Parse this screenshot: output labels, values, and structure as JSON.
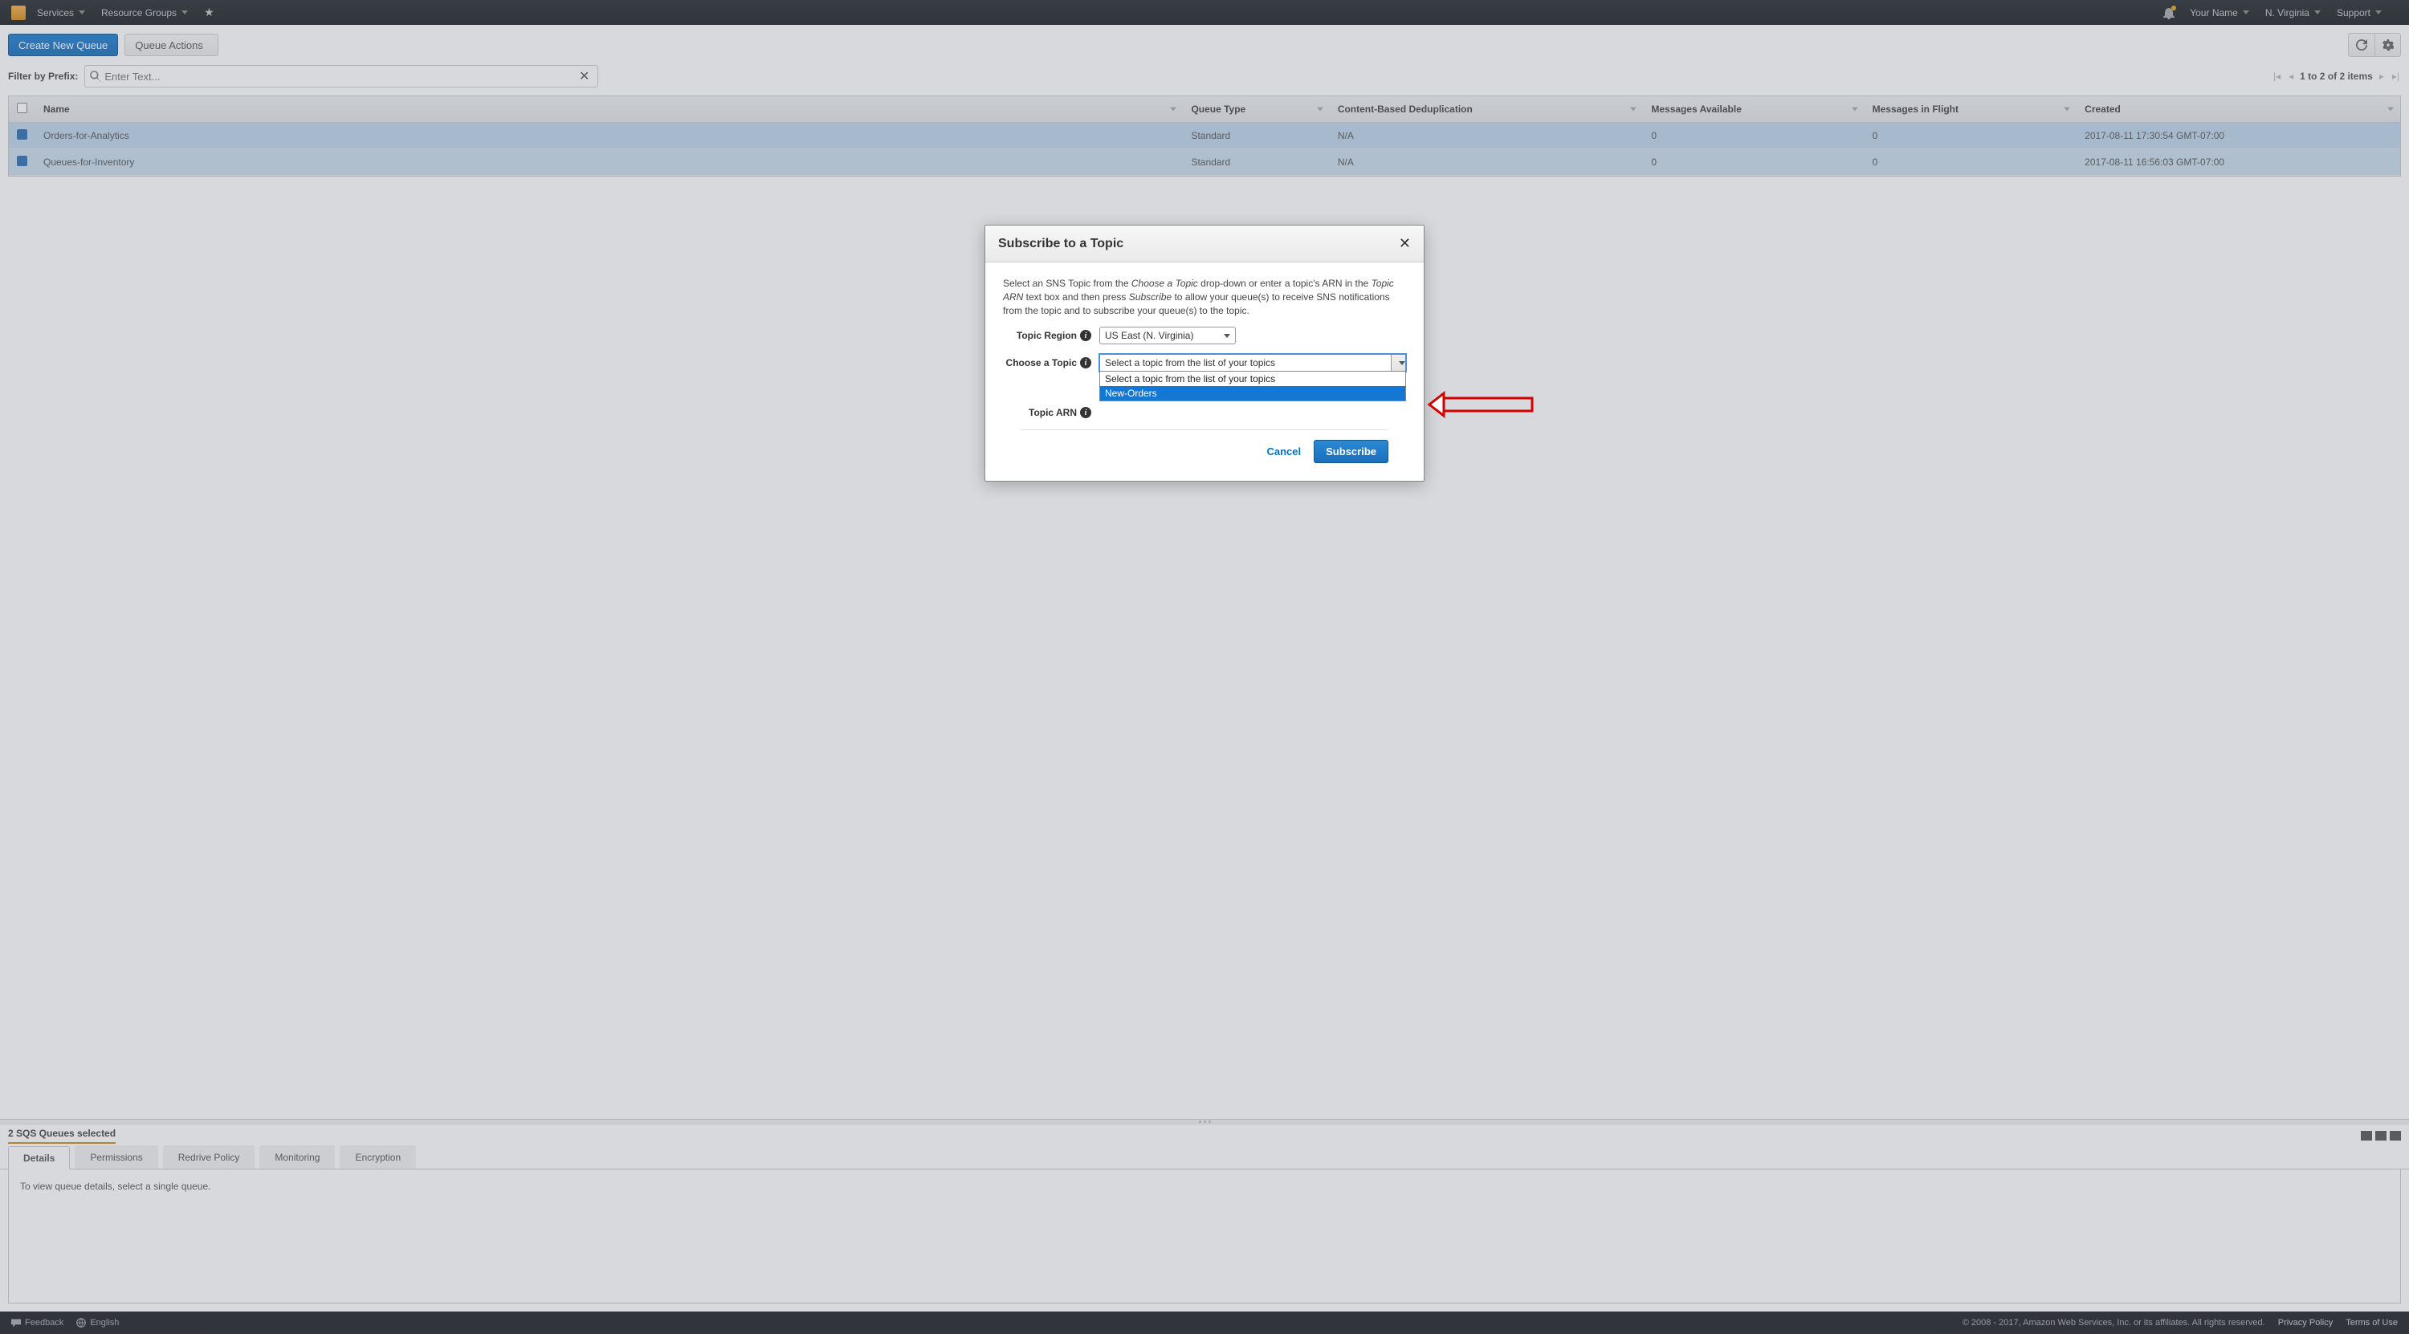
{
  "topnav": {
    "services": "Services",
    "resource_groups": "Resource Groups",
    "username": "Your Name",
    "region": "N. Virginia",
    "support": "Support"
  },
  "actionbar": {
    "create_queue": "Create New Queue",
    "queue_actions": "Queue Actions"
  },
  "filter": {
    "label": "Filter by Prefix:",
    "placeholder": "Enter Text...",
    "pager_text": "1 to 2 of 2 items"
  },
  "columns": {
    "name": "Name",
    "queue_type": "Queue Type",
    "dedup": "Content-Based Deduplication",
    "msgs_avail": "Messages Available",
    "msgs_flight": "Messages in Flight",
    "created": "Created"
  },
  "rows": [
    {
      "name": "Orders-for-Analytics",
      "type": "Standard",
      "dedup": "N/A",
      "avail": "0",
      "flight": "0",
      "created": "2017-08-11 17:30:54 GMT-07:00"
    },
    {
      "name": "Queues-for-Inventory",
      "type": "Standard",
      "dedup": "N/A",
      "avail": "0",
      "flight": "0",
      "created": "2017-08-11 16:56:03 GMT-07:00"
    }
  ],
  "panel": {
    "title": "2 SQS Queues selected",
    "tabs": {
      "details": "Details",
      "permissions": "Permissions",
      "redrive": "Redrive Policy",
      "monitoring": "Monitoring",
      "encryption": "Encryption"
    },
    "details_msg": "To view queue details, select a single queue."
  },
  "footer": {
    "feedback": "Feedback",
    "language": "English",
    "copyright": "© 2008 - 2017, Amazon Web Services, Inc. or its affiliates. All rights reserved.",
    "privacy": "Privacy Policy",
    "terms": "Terms of Use"
  },
  "modal": {
    "title": "Subscribe to a Topic",
    "desc_1": "Select an SNS Topic from the ",
    "desc_em1": "Choose a Topic",
    "desc_2": " drop-down or enter a topic's ARN in the ",
    "desc_em2": "Topic ARN",
    "desc_3": " text box and then press ",
    "desc_em3": "Subscribe",
    "desc_4": " to allow your queue(s) to receive SNS notifications from the topic and to subscribe your queue(s) to the topic.",
    "label_region": "Topic Region",
    "label_choose": "Choose a Topic",
    "label_arn": "Topic ARN",
    "region_value": "US East (N. Virginia)",
    "choose_value": "Select a topic from the list of your topics",
    "options": {
      "placeholder": "Select a topic from the list of your topics",
      "opt1": "New-Orders"
    },
    "cancel": "Cancel",
    "subscribe": "Subscribe"
  }
}
